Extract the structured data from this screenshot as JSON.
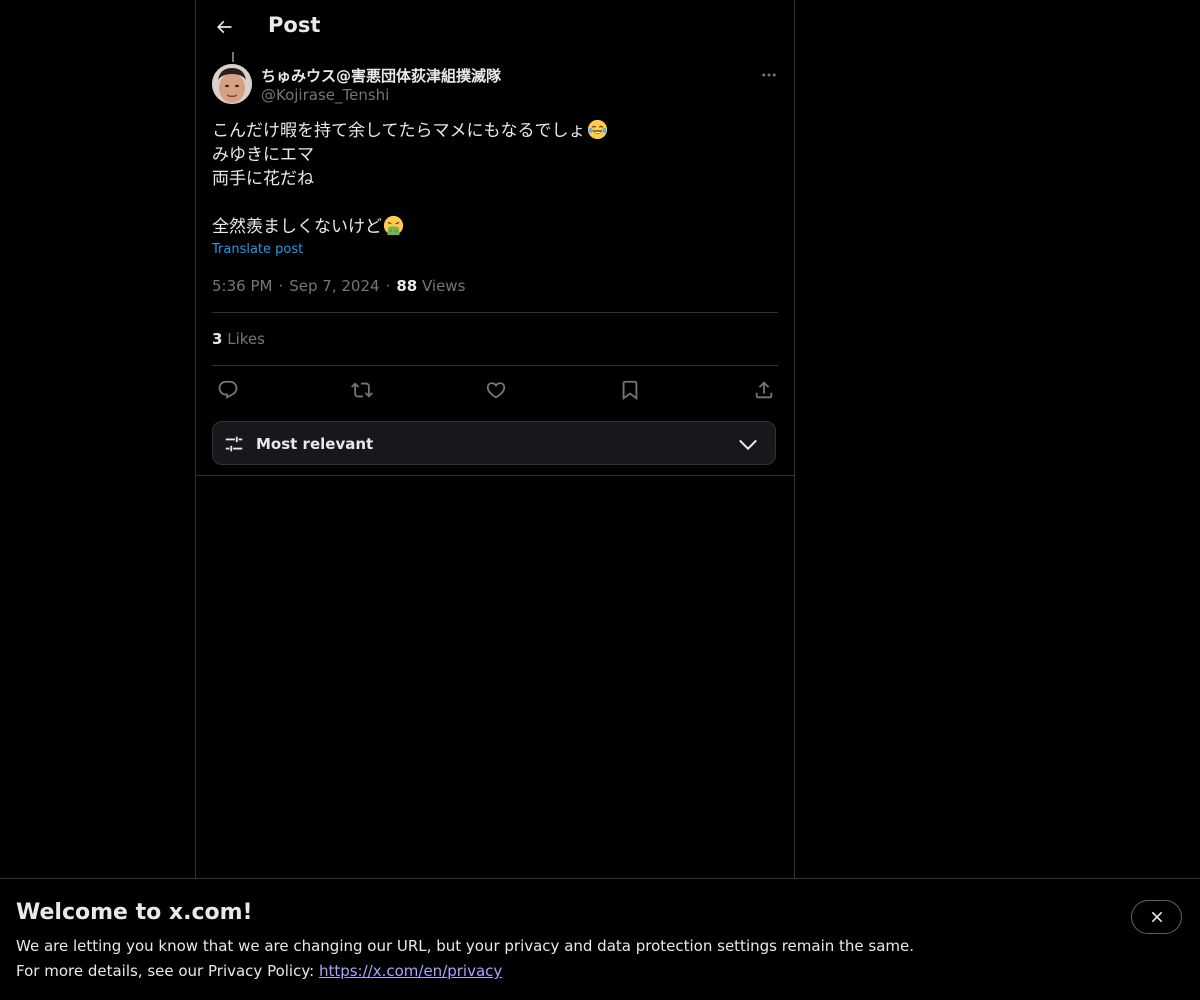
{
  "header": {
    "title": "Post"
  },
  "post": {
    "author": {
      "display_name": "ちゅみウス@害悪団体荻津組撲滅隊",
      "handle": "@Kojirase_Tenshi"
    },
    "text_lines": [
      "こんだけ暇を持て余してたらマメにもなるでしょ",
      "みゆきにエマ",
      "両手に花だね",
      "",
      "全然羨ましくないけど"
    ],
    "emojis": [
      "face-with-tears-of-joy",
      "face-vomiting"
    ],
    "translate_label": "Translate post",
    "time": "5:36 PM",
    "date": "Sep 7, 2024",
    "views_count": "88",
    "views_label": "Views",
    "likes_count": "3",
    "likes_label": "Likes",
    "actions": [
      "reply-icon",
      "repost-icon",
      "like-icon",
      "bookmark-icon",
      "share-icon"
    ]
  },
  "sort": {
    "label": "Most relevant"
  },
  "banner": {
    "title": "Welcome to x.com!",
    "line1": "We are letting you know that we are changing our URL, but your privacy and data protection settings remain the same.",
    "line2_prefix": "For more details, see our Privacy Policy: ",
    "link": "https://x.com/en/privacy"
  },
  "colors": {
    "background": "#000000",
    "text_primary": "#e7e9ea",
    "text_secondary": "#71767b",
    "accent": "#1d9bf0",
    "border": "#2f3336",
    "link": "#a8a4ff"
  }
}
